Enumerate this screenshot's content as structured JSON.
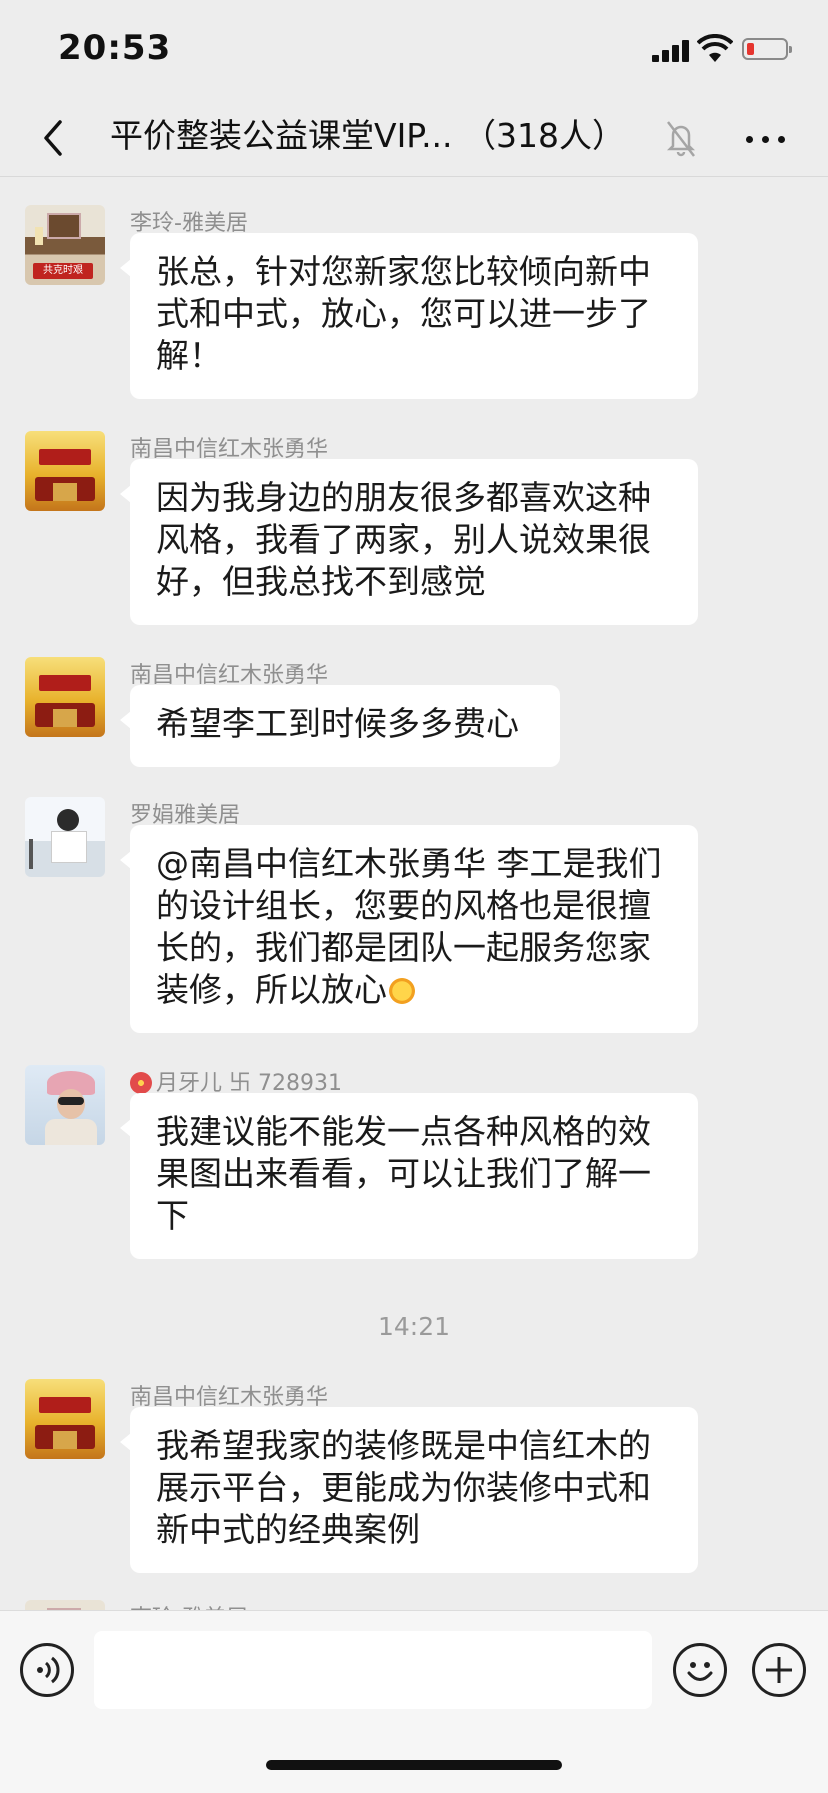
{
  "status": {
    "time": "20:53",
    "battery_color": "#e5352f"
  },
  "header": {
    "title": "平价整装公益课堂VIP... （318人）",
    "icons": [
      "back-chevron-icon",
      "mute-bell-icon",
      "more-dots-icon"
    ]
  },
  "messages": [
    {
      "sender": "李玲-雅美居",
      "text": "张总，针对您新家您比较倾向新中式和中式，放心，您可以进一步了解！",
      "avatar_badge": "共克时艰"
    },
    {
      "sender": "南昌中信红木张勇华",
      "text": "因为我身边的朋友很多都喜欢这种风格，我看了两家，别人说效果很好，但我总找不到感觉"
    },
    {
      "sender": "南昌中信红木张勇华",
      "text": "希望李工到时候多多费心"
    },
    {
      "sender": "罗娟雅美居",
      "text": "@南昌中信红木张勇华 李工是我们的设计组长，您要的风格也是很擅长的，我们都是团队一起服务您家装修，所以放心",
      "emoji": "sun-emoji"
    },
    {
      "sender": "月牙儿 卐 728931",
      "text": "我建议能不能发一点各种风格的效果图出来看看，可以让我们了解一下",
      "sender_emoji": "hibiscus-emoji"
    },
    {
      "sender": "南昌中信红木张勇华",
      "text": "我希望我家的装修既是中信红木的展示平台，更能成为你装修中式和新中式的经典案例"
    },
    {
      "sender": "李玲-雅美居"
    }
  ],
  "timestamp": "14:21",
  "input": {
    "placeholder": ""
  }
}
